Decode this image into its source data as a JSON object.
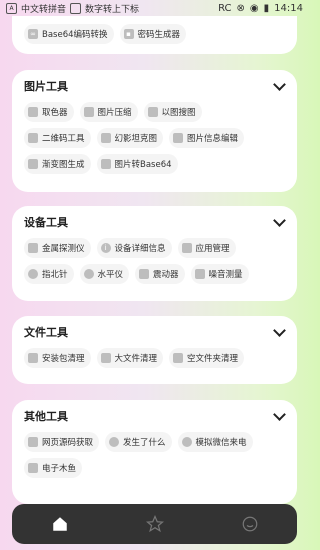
{
  "status_bar": {
    "left_items": [
      "A",
      "中文转拼音",
      "数字转上下标"
    ],
    "rc": "RC",
    "time": "14:14"
  },
  "top_card": {
    "items": [
      "Base64编码转换",
      "密码生成器"
    ]
  },
  "sections": [
    {
      "title": "图片工具",
      "rows": [
        [
          "取色器",
          "图片压缩",
          "以图搜图"
        ],
        [
          "二维码工具",
          "幻影坦克图",
          "图片信息编辑"
        ],
        [
          "渐变图生成",
          "图片转Base64"
        ]
      ]
    },
    {
      "title": "设备工具",
      "rows": [
        [
          "金属探测仪",
          "设备详细信息",
          "应用管理"
        ],
        [
          "指北针",
          "水平仪",
          "震动器",
          "噪音测量"
        ]
      ]
    },
    {
      "title": "文件工具",
      "rows": [
        [
          "安装包清理",
          "大文件清理",
          "空文件夹清理"
        ]
      ]
    },
    {
      "title": "其他工具",
      "rows": [
        [
          "网页源码获取",
          "发生了什么",
          "模拟微信来电"
        ],
        [
          "电子木鱼"
        ]
      ]
    }
  ],
  "nav": [
    "home-icon",
    "star-icon",
    "smile-icon"
  ]
}
